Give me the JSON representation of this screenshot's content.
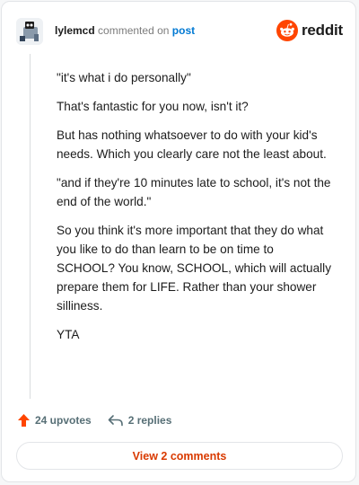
{
  "header": {
    "author": "lylemcd",
    "action": "commented on",
    "link": "post",
    "brand": "reddit"
  },
  "comment": {
    "paragraphs": [
      "\"it's what i do personally\"",
      "That's fantastic for you now, isn't it?",
      "But has nothing whatsoever to do with your kid's needs. Which you clearly care not the least about.",
      "\"and if they're 10 minutes late to school, it's not the end of the world.\"",
      "So you think it's more important that they do what you like to do than learn to be on time to SCHOOL? You know, SCHOOL, which will actually prepare them for LIFE. Rather than your shower silliness.",
      "YTA"
    ]
  },
  "footer": {
    "upvotes": "24 upvotes",
    "replies": "2 replies",
    "view_button": "View 2 comments"
  },
  "colors": {
    "accent": "#ff4500",
    "link": "#0079d3",
    "button_text": "#d93a00",
    "muted": "#576f76"
  },
  "icons": [
    "avatar-snoo",
    "reddit-logo-icon",
    "upvote-arrow-icon",
    "reply-arrow-icon"
  ]
}
